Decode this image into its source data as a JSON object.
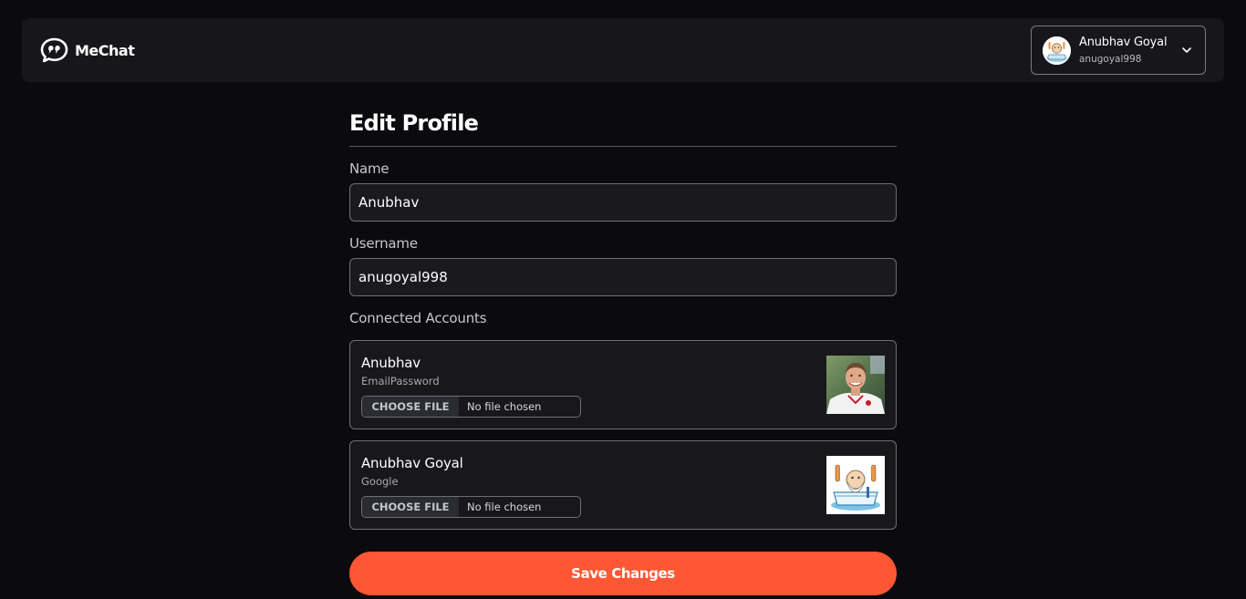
{
  "header": {
    "brand_name": "MeChat",
    "brand_icon": "chat-quote-icon",
    "user": {
      "name": "Anubhav Goyal",
      "handle": "anugoyal998",
      "avatar_icon": "user-avatar-icon",
      "chevron_icon": "chevron-down-icon"
    }
  },
  "main": {
    "title": "Edit Profile",
    "name_label": "Name",
    "name_value": "Anubhav",
    "username_label": "Username",
    "username_value": "anugoyal998",
    "connected_label": "Connected Accounts",
    "accounts": [
      {
        "name": "Anubhav",
        "provider": "EmailPassword",
        "file_button": "CHOOSE FILE",
        "file_status": "No file chosen",
        "photo": "profile-photo"
      },
      {
        "name": "Anubhav Goyal",
        "provider": "Google",
        "file_button": "CHOOSE FILE",
        "file_status": "No file chosen",
        "photo": "cartoon-avatar"
      }
    ],
    "save_label": "Save Changes"
  },
  "colors": {
    "background": "#0b0b0f",
    "header_bg": "#17171b",
    "accent": "#ff5733",
    "border": "#6e6e74"
  }
}
